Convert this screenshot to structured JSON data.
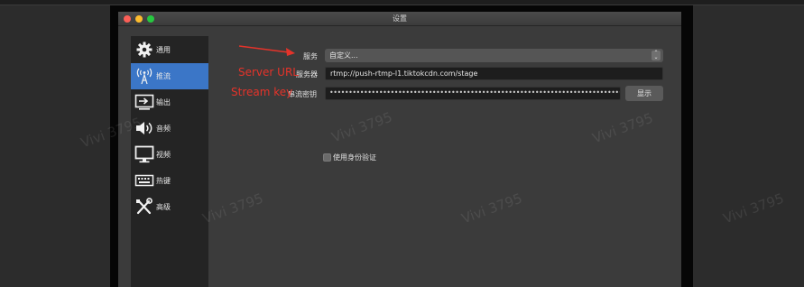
{
  "window": {
    "title": "设置"
  },
  "sidebar": {
    "items": [
      {
        "label": "通用",
        "icon": "gear-icon"
      },
      {
        "label": "推流",
        "icon": "broadcast-icon"
      },
      {
        "label": "输出",
        "icon": "output-icon"
      },
      {
        "label": "音频",
        "icon": "speaker-icon"
      },
      {
        "label": "视频",
        "icon": "monitor-icon"
      },
      {
        "label": "热键",
        "icon": "keyboard-icon"
      },
      {
        "label": "高级",
        "icon": "tools-icon"
      }
    ],
    "active_index": 1
  },
  "form": {
    "service_label": "服务",
    "service_value": "自定义...",
    "server_label": "服务器",
    "server_value": "rtmp://push-rtmp-l1.tiktokcdn.com/stage",
    "key_label": "串流密钥",
    "key_value": "••••••••••••••••••••••••••••••••••••••••••••••••••••••••••••••••••••••••••••••••••••••••••••••••••",
    "show_button": "显示",
    "auth_label": "使用身份验证",
    "auth_checked": false
  },
  "annotations": {
    "server_url": "Server URL",
    "stream_key": "Stream key",
    "color": "#e5332a"
  },
  "watermark": "Vivi 3795",
  "colors": {
    "accent": "#3b76c7",
    "window_bg": "#3b3b3b",
    "sidebar_bg": "#242424"
  }
}
